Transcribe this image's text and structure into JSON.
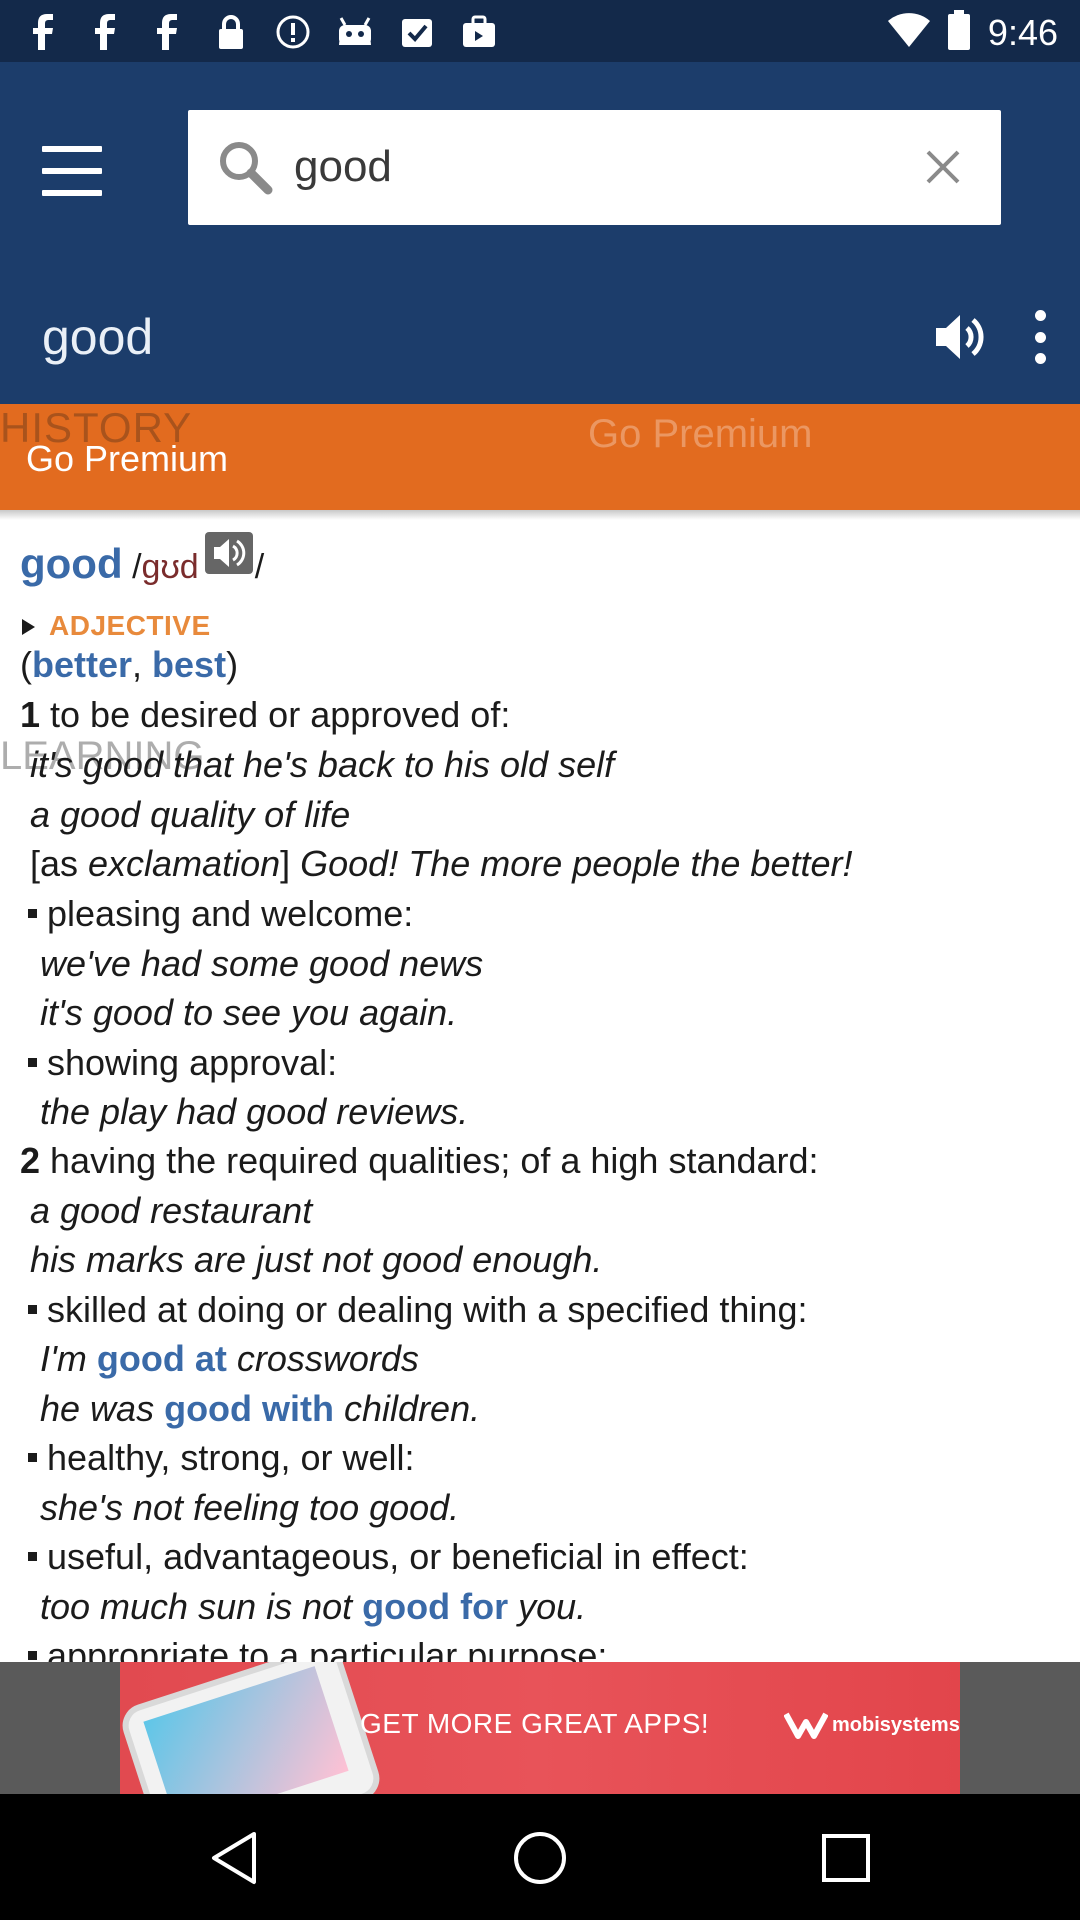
{
  "status_bar": {
    "time": "9:46",
    "icons": [
      "facebook-icon",
      "facebook-icon",
      "facebook-icon",
      "lock-icon",
      "info-icon",
      "android-icon",
      "clipboard-check-icon",
      "bag-icon",
      "wifi-icon",
      "battery-icon"
    ]
  },
  "search": {
    "value": "good",
    "placeholder": ""
  },
  "word_header": {
    "title": "good"
  },
  "premium_bar": {
    "ghost_history": "HISTORY",
    "ghost_premium": "Go Premium",
    "label": "Go Premium"
  },
  "entry": {
    "headword": "good",
    "pron_open": " /",
    "pron": "ɡʊd",
    "pron_close": "/",
    "part_of_speech": "ADJECTIVE",
    "forms_open": "(",
    "comparative": "better",
    "forms_sep": ", ",
    "superlative": "best",
    "forms_close": ")",
    "ghost_learning": "LEARNING",
    "sense1_num": "1",
    "sense1_def": " to be desired or approved of:",
    "ex1a": "it's good that he's back to his old self",
    "ex1b": "a good quality of life",
    "ex1c_pre": "[as ",
    "ex1c_mid": "exclamation",
    "ex1c_post": "] ",
    "ex1c_it": "Good! The more people the better!",
    "sub1a": "pleasing and welcome:",
    "ex1d": "we've had some good news",
    "ex1e": "it's good to see you again.",
    "sub1b": "showing approval:",
    "ex1f": "the play had good reviews.",
    "sense2_num": "2",
    "sense2_def": " having the required qualities; of a high standard:",
    "ex2a": "a good restaurant",
    "ex2b": "his marks are just not good enough.",
    "sub2a": "skilled at doing or dealing with a specified thing:",
    "ex2c_pre": "I'm ",
    "ex2c_link": "good at",
    "ex2c_post": " crosswords",
    "ex2d_pre": "he was ",
    "ex2d_link": "good with",
    "ex2d_post": " children.",
    "sub2b": "healthy, strong, or well:",
    "ex2e": "she's not feeling too good.",
    "sub2c": "useful, advantageous, or beneficial in effect:",
    "ex2f_pre": "too much sun is not ",
    "ex2f_link": "good for",
    "ex2f_post": " you.",
    "sub2d": "appropriate to a particular purpose:"
  },
  "ad": {
    "text": "GET MORE GREAT APPS!",
    "brand": "mobisystems"
  },
  "nav": {
    "buttons": [
      "back-icon",
      "home-icon",
      "recents-icon"
    ]
  },
  "colors": {
    "toolbar": "#1c3d6b",
    "status_bar": "#13294a",
    "premium": "#e26b1f",
    "link": "#3a6aa8",
    "part_of_speech": "#e88a3c",
    "ad": "#e14a50"
  }
}
